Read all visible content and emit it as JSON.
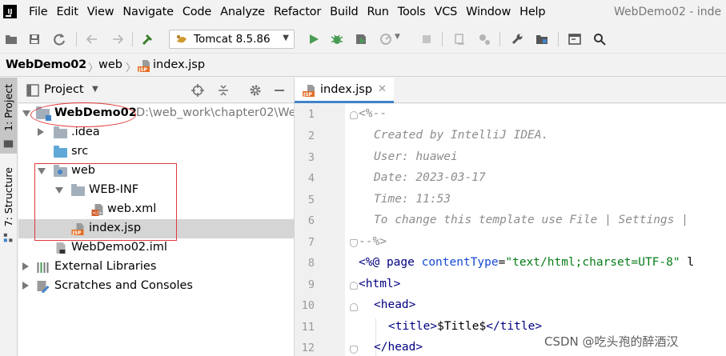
{
  "menu": {
    "items": [
      "File",
      "Edit",
      "View",
      "Navigate",
      "Code",
      "Analyze",
      "Refactor",
      "Build",
      "Run",
      "Tools",
      "VCS",
      "Window",
      "Help"
    ],
    "window_title": "WebDemo02 - inde"
  },
  "toolbar": {
    "run_config": "Tomcat 8.5.86",
    "icons": [
      "open-icon",
      "save-icon",
      "sync-icon",
      "back-icon",
      "forward-icon",
      "build-hammer-icon",
      "tomcat-icon",
      "run-icon",
      "debug-icon",
      "coverage-icon",
      "profile-icon",
      "stop-icon",
      "sdk-icon",
      "project-structure-icon",
      "settings-icon",
      "structure-icon",
      "terminal-icon",
      "search-icon"
    ]
  },
  "breadcrumb": {
    "project": "WebDemo02",
    "folder": "web",
    "file": "index.jsp"
  },
  "stripe": {
    "project_label": "1: Project",
    "structure_label": "7: Structure"
  },
  "project_panel": {
    "title": "Project",
    "tree": [
      {
        "label": "WebDemo02",
        "suffix": "D:\\web_work\\chapter02\\We"
      },
      {
        "label": ".idea"
      },
      {
        "label": "src"
      },
      {
        "label": "web"
      },
      {
        "label": "WEB-INF"
      },
      {
        "label": "web.xml"
      },
      {
        "label": "index.jsp"
      },
      {
        "label": "WebDemo02.iml"
      },
      {
        "label": "External Libraries"
      },
      {
        "label": "Scratches and Consoles"
      }
    ]
  },
  "editor": {
    "tab": "index.jsp",
    "line_numbers": [
      "1",
      "2",
      "3",
      "4",
      "5",
      "6",
      "7",
      "8",
      "9",
      "10",
      "11",
      "12"
    ],
    "comment": {
      "open": "<%--",
      "created": "Created by IntelliJ IDEA.",
      "user": "User: huawei",
      "date": "Date: 2023-03-17",
      "time": "Time: 11:53",
      "template": "To change this template use File | Settings |",
      "close": "--%>"
    },
    "directive": {
      "open": "<%@",
      "keyword": "page",
      "attr": "contentType",
      "value": "\"text/html;charset=UTF-8\"",
      "rest": " l"
    },
    "html_open": "<html>",
    "head_open": "<head>",
    "title_open": "<title>",
    "title_text": "$Title$",
    "title_close": "</title>",
    "head_close": "</head>"
  },
  "watermark": "CSDN @吃头孢的醉酒汉"
}
